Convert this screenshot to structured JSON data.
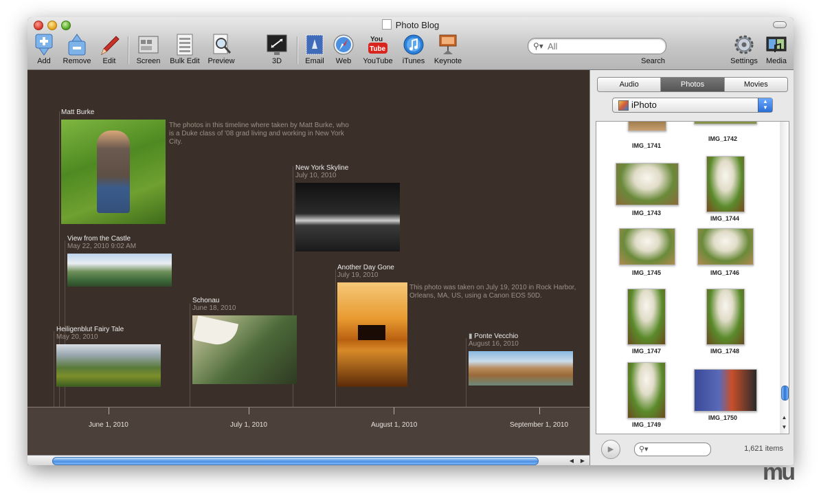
{
  "window": {
    "title": "Photo Blog"
  },
  "toolbar": {
    "add": "Add",
    "remove": "Remove",
    "edit": "Edit",
    "screen": "Screen",
    "bulk_edit": "Bulk Edit",
    "preview": "Preview",
    "three_d": "3D",
    "email": "Email",
    "web": "Web",
    "youtube": "YouTube",
    "youtube_logo": "You Tube",
    "itunes": "iTunes",
    "keynote": "Keynote",
    "search_placeholder": "All",
    "search_label": "Search",
    "settings": "Settings",
    "media": "Media"
  },
  "timeline": {
    "events": [
      {
        "title": "Matt Burke",
        "date": "",
        "desc": "The photos in this timeline where taken by Matt Burke, who is a Duke class of '08 grad living and working in New York City."
      },
      {
        "title": "View from the Castle",
        "date": "May 22, 2010 9:02 AM",
        "desc": ""
      },
      {
        "title": "Heiligenblut Fairy Tale",
        "date": "May 20, 2010",
        "desc": ""
      },
      {
        "title": "Schonau",
        "date": "June 18, 2010",
        "desc": ""
      },
      {
        "title": "New York Skyline",
        "date": "July 10, 2010",
        "desc": ""
      },
      {
        "title": "Another Day Gone",
        "date": "July 19, 2010",
        "desc": "This photo was taken on July 19, 2010 in Rock Harbor, Orleans, MA, US, using a Canon EOS 50D."
      },
      {
        "title": "Ponte Vecchio",
        "date": "August 16, 2010",
        "desc": ""
      }
    ],
    "axis_labels": [
      "June 1, 2010",
      "July 1, 2010",
      "August 1, 2010",
      "September 1, 2010"
    ]
  },
  "sidebar": {
    "tabs": [
      "Audio",
      "Photos",
      "Movies"
    ],
    "selected_tab": "Photos",
    "source": "iPhoto",
    "photos": [
      "IMG_1741",
      "IMG_1742",
      "IMG_1743",
      "IMG_1744",
      "IMG_1745",
      "IMG_1746",
      "IMG_1747",
      "IMG_1748",
      "IMG_1749",
      "IMG_1750"
    ],
    "count": "1,621 items"
  },
  "logo": "mu"
}
